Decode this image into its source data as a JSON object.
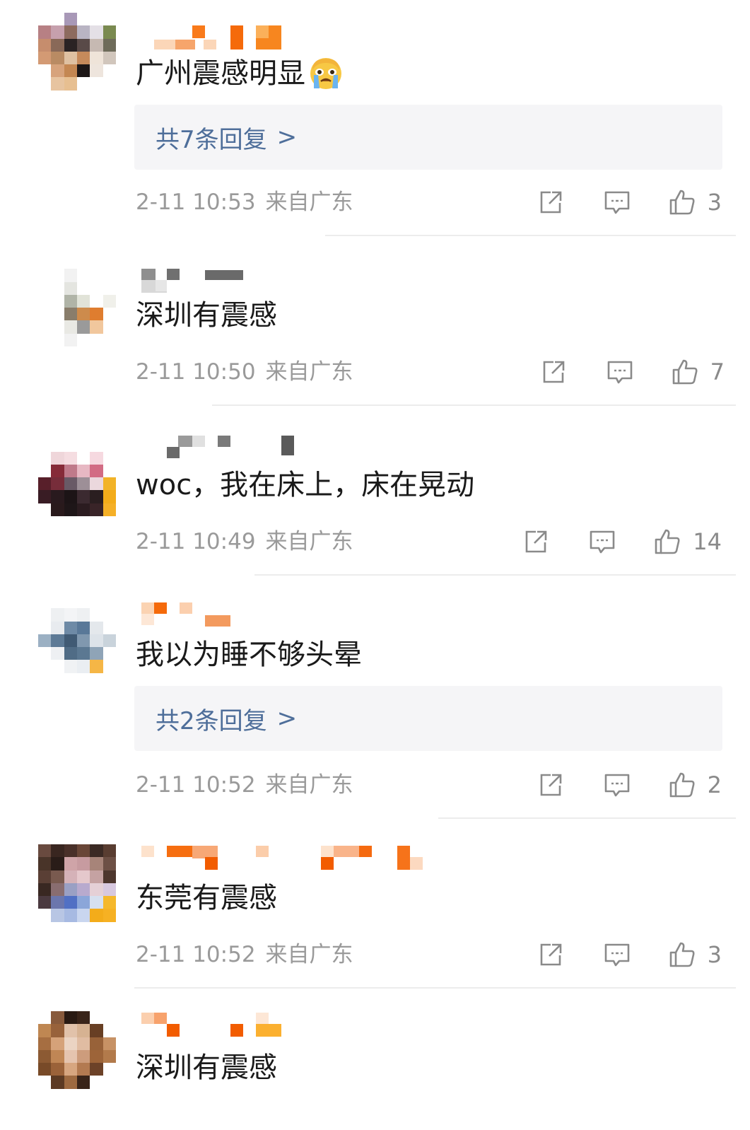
{
  "comments": [
    {
      "text": "广州震感明显",
      "has_emoji": true,
      "emoji": "loudly-crying-face",
      "replies_label": "共7条回复",
      "replies_chevron": ">",
      "time": "2-11 10:53",
      "location": "来自广东",
      "likes": "3"
    },
    {
      "text": "深圳有震感",
      "time": "2-11 10:50",
      "location": "来自广东",
      "likes": "7"
    },
    {
      "text": "woc，我在床上，床在晃动",
      "time": "2-11 10:49",
      "location": "来自广东",
      "likes": "14"
    },
    {
      "text": "我以为睡不够头晕",
      "replies_label": "共2条回复",
      "replies_chevron": ">",
      "time": "2-11 10:52",
      "location": "来自广东",
      "likes": "2"
    },
    {
      "text": "东莞有震感",
      "time": "2-11 10:52",
      "location": "来自广东",
      "likes": "3"
    },
    {
      "text": "深圳有震感"
    }
  ],
  "icons": {
    "share": "share-icon",
    "reply": "comment-icon",
    "like": "thumbs-up-icon"
  },
  "colors": {
    "reply_link": "#4e6e9a",
    "meta_text": "#9a9a9a",
    "reply_box_bg": "#f5f5f7",
    "icon_gray": "#8a8a8a"
  }
}
